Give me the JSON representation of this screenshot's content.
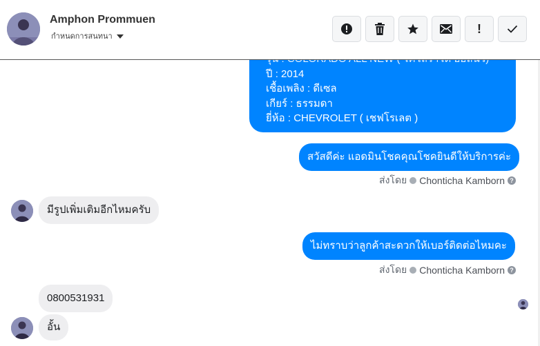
{
  "header": {
    "contact_name": "Amphon Prommuen",
    "subtitle": "กำหนดการสนทนา",
    "actions": [
      {
        "name": "report-button",
        "icon": "alert-circle-icon"
      },
      {
        "name": "delete-button",
        "icon": "trash-icon"
      },
      {
        "name": "star-button",
        "icon": "star-icon"
      },
      {
        "name": "mail-button",
        "icon": "mail-icon"
      },
      {
        "name": "mark-important-button",
        "icon": "exclamation-icon",
        "label": "!"
      },
      {
        "name": "mark-done-button",
        "icon": "check-icon"
      }
    ]
  },
  "messages": {
    "product_card": {
      "line_partial": "รุ่น : COLORADO ALL NEW ( โคโลราโด ออลนิว)",
      "year": "ปี : 2014",
      "fuel": "เชื้อเพลิง : ดีเซล",
      "gear": "เกียร์ : ธรรมดา",
      "brand": "ยี่ห้อ : CHEVROLET ( เชฟโรเลต )"
    },
    "greeting": "สวัสดีค่ะ แอดมินโชคคุณโชคยินดีให้บริการค่ะ",
    "sent_by_label": "ส่งโดย",
    "sent_by_name": "Chonticha Kamborn",
    "question_mark": "?",
    "customer_q1": "มีรูปเพิ่มเติมอีกไหมครับ",
    "admin_q2": "ไม่ทราบว่าลูกค้าสะดวกให้เบอร์ติดต่อไหมคะ",
    "customer_phone": "0800531931",
    "customer_last": "อั้น"
  },
  "colors": {
    "outgoing_bubble": "#0084ff",
    "incoming_bubble": "#eeeef0"
  }
}
